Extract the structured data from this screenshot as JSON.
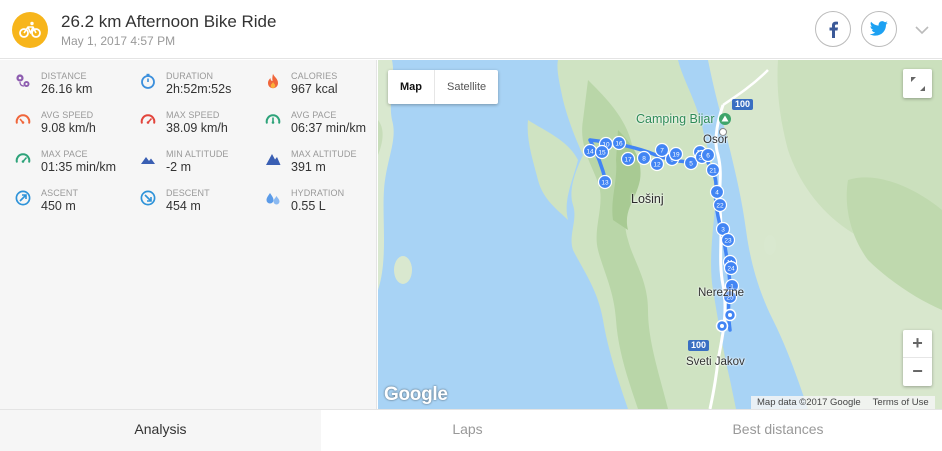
{
  "header": {
    "title": "26.2 km Afternoon Bike Ride",
    "date": "May 1, 2017 4:57 PM",
    "sport_icon": "bicycle-icon",
    "accent": "#f7b51b"
  },
  "share": {
    "facebook_icon": "facebook-icon",
    "facebook_color": "#3b5998",
    "twitter_icon": "twitter-icon",
    "twitter_color": "#1da1f2"
  },
  "stats": [
    {
      "label": "DISTANCE",
      "value": "26.16 km",
      "icon": "distance-pin-icon",
      "color": "#8e5db0"
    },
    {
      "label": "DURATION",
      "value": "2h:52m:52s",
      "icon": "stopwatch-icon",
      "color": "#3b8fdc"
    },
    {
      "label": "CALORIES",
      "value": "967 kcal",
      "icon": "flame-icon",
      "color": "#f0663b"
    },
    {
      "label": "AVG SPEED",
      "value": "9.08 km/h",
      "icon": "speedometer-icon",
      "color": "#f0663b"
    },
    {
      "label": "MAX SPEED",
      "value": "38.09 km/h",
      "icon": "speedometer-icon",
      "color": "#e2453c"
    },
    {
      "label": "AVG PACE",
      "value": "06:37 min/km",
      "icon": "pace-gauge-icon",
      "color": "#2ea37a"
    },
    {
      "label": "MAX PACE",
      "value": "01:35 min/km",
      "icon": "pace-gauge-icon",
      "color": "#2ea37a"
    },
    {
      "label": "MIN ALTITUDE",
      "value": "-2 m",
      "icon": "mountain-low-icon",
      "color": "#3a5fb3"
    },
    {
      "label": "MAX ALTITUDE",
      "value": "391 m",
      "icon": "mountain-high-icon",
      "color": "#3a5fb3"
    },
    {
      "label": "ASCENT",
      "value": "450 m",
      "icon": "ascent-arrow-icon",
      "color": "#2e93d9"
    },
    {
      "label": "DESCENT",
      "value": "454 m",
      "icon": "descent-arrow-icon",
      "color": "#2e93d9"
    },
    {
      "label": "HYDRATION",
      "value": "0.55 L",
      "icon": "water-drops-icon",
      "color": "#5b9be8"
    }
  ],
  "map": {
    "type_map": "Map",
    "type_satellite": "Satellite",
    "zoom_in": "+",
    "zoom_out": "−",
    "logo": "Google",
    "map_data": "Map data ©2017 Google",
    "terms": "Terms of Use",
    "labels": {
      "camping": "Camping Bijar",
      "osor": "Osor",
      "losinj": "Lošinj",
      "nerezine": "Nerezine",
      "sveti_jakov": "Sveti Jakov",
      "road_top": "100",
      "road_bottom": "100"
    },
    "markers": [
      "1",
      "3",
      "4",
      "5",
      "6",
      "7",
      "8",
      "9",
      "10",
      "11",
      "12",
      "13",
      "14",
      "15",
      "16",
      "17",
      "18",
      "19",
      "20",
      "21",
      "22",
      "23",
      "24",
      "25"
    ]
  },
  "tabs": [
    {
      "label": "Analysis",
      "active": true
    },
    {
      "label": "Laps",
      "active": false
    },
    {
      "label": "Best distances",
      "active": false
    }
  ]
}
